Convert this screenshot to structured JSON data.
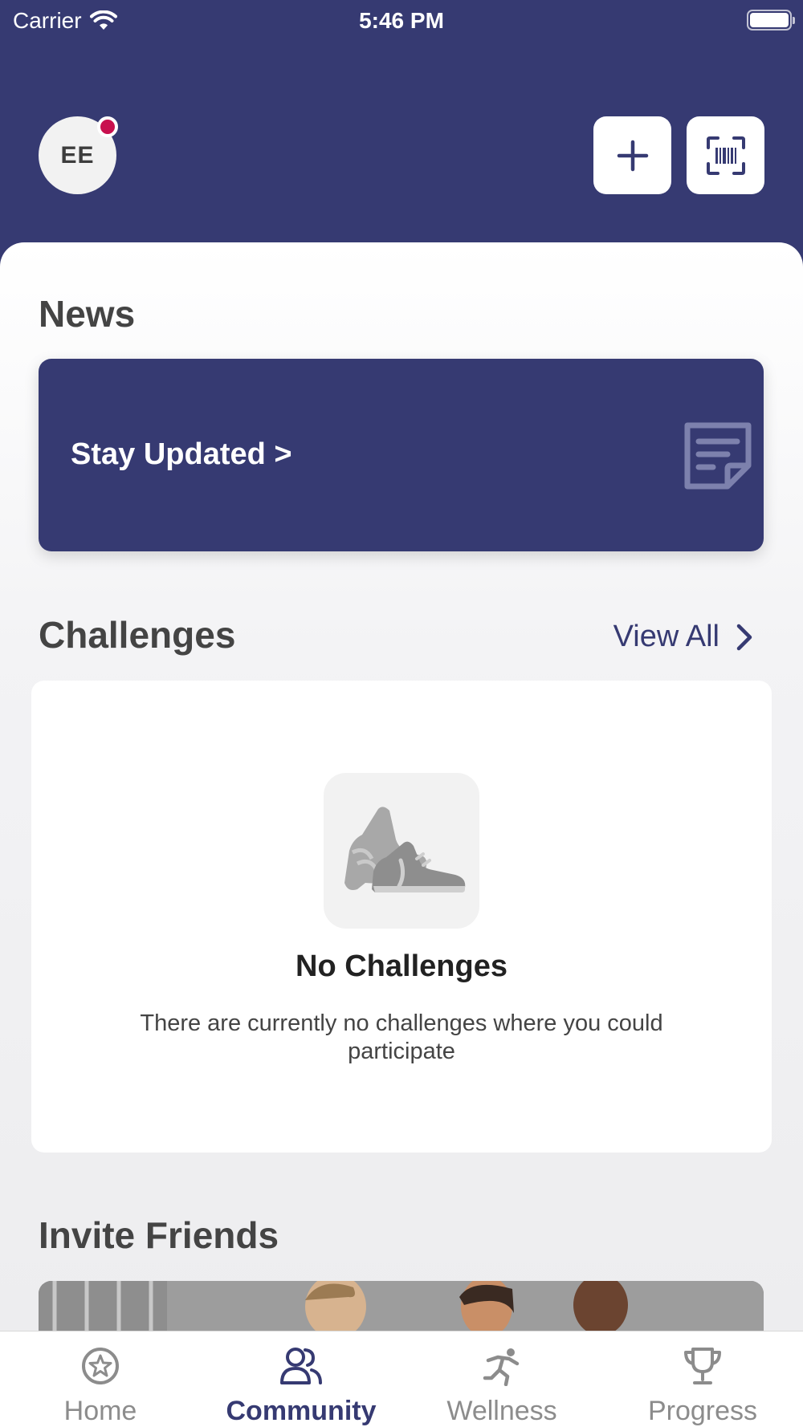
{
  "status_bar": {
    "carrier": "Carrier",
    "time": "5:46 PM"
  },
  "header": {
    "avatar_initials": "EE",
    "add_icon": "plus-icon",
    "scan_icon": "barcode-scan-icon"
  },
  "news": {
    "title": "News",
    "card_text": "Stay Updated >",
    "card_icon": "note-icon"
  },
  "challenges": {
    "title": "Challenges",
    "view_all": "View All",
    "empty_title": "No Challenges",
    "empty_description": "There are currently no challenges where you could participate",
    "empty_icon": "sneakers-icon"
  },
  "invite": {
    "title": "Invite Friends"
  },
  "tabs": [
    {
      "label": "Home",
      "icon": "star-circle-icon"
    },
    {
      "label": "Community",
      "icon": "users-icon"
    },
    {
      "label": "Wellness",
      "icon": "running-icon"
    },
    {
      "label": "Progress",
      "icon": "trophy-icon"
    }
  ],
  "colors": {
    "brand": "#363a72",
    "notification": "#c8104e",
    "tab_inactive": "#8c8c8c"
  }
}
